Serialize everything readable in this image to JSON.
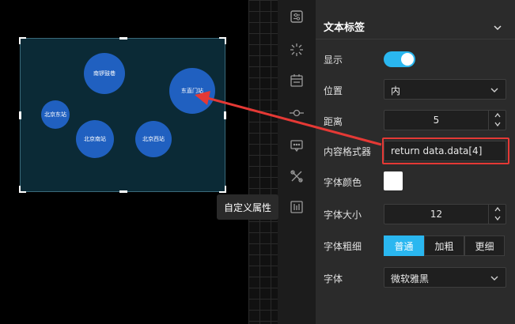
{
  "chart": {
    "bubbles": [
      {
        "label": "南锣鼓巷"
      },
      {
        "label": "东直门站"
      },
      {
        "label": "北京东站"
      },
      {
        "label": "北京南站"
      },
      {
        "label": "北京西站"
      }
    ]
  },
  "tooltip": "自定义属性",
  "toolbar": {
    "icons": [
      "style-icon",
      "effect-icon",
      "calendar-icon",
      "connector-icon",
      "message-icon",
      "tools-icon",
      "data-icon"
    ]
  },
  "panel": {
    "title": "文本标签",
    "show_label": "显示",
    "show_value": true,
    "position_label": "位置",
    "position_value": "内",
    "distance_label": "距离",
    "distance_value": "5",
    "formatter_label": "内容格式器",
    "formatter_value": "return data.data[4]",
    "font_color_label": "字体颜色",
    "font_color_value": "#ffffff",
    "font_size_label": "字体大小",
    "font_size_value": "12",
    "font_weight_label": "字体粗细",
    "font_weight_options": [
      "普通",
      "加粗",
      "更细"
    ],
    "font_weight_selected": "普通",
    "font_family_label": "字体",
    "font_family_value": "微软雅黑"
  },
  "colors": {
    "accent": "#2ab7f0",
    "bubble": "#2060c0",
    "highlight": "#e53935"
  }
}
